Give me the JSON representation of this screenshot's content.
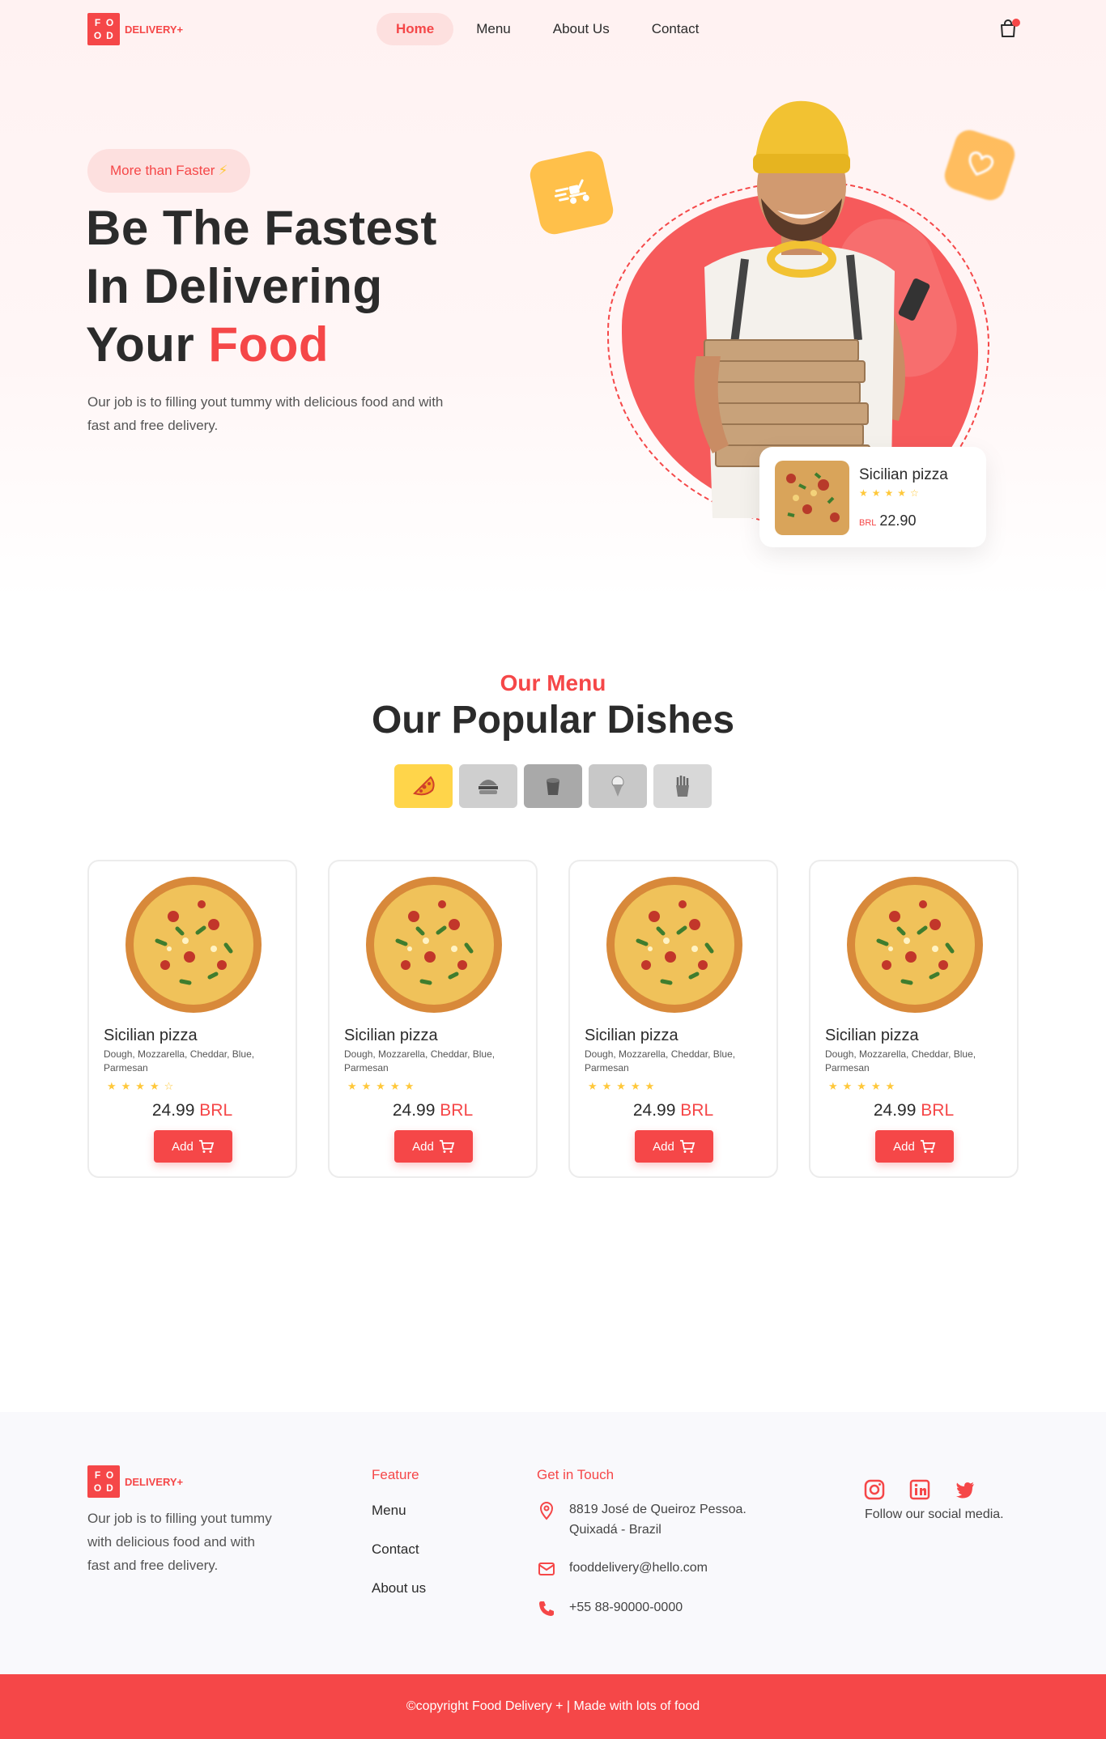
{
  "brand": {
    "logo_letters": [
      "F",
      "O",
      "O",
      "D"
    ],
    "name": "DELIVERY+",
    "accent": "#f54748",
    "star_color": "#ffc83a"
  },
  "nav": {
    "items": [
      "Home",
      "Menu",
      "About Us",
      "Contact"
    ],
    "active": "Home"
  },
  "cart": {
    "icon": "shopping-bag-icon",
    "has_notification": true
  },
  "hero": {
    "badge": "More than Faster",
    "badge_icon": "⚡",
    "title_line1": "Be The Fastest",
    "title_line2": "In Delivering",
    "title_line3_plain": "Your",
    "title_line3_accent": "Food",
    "description": "Our job is to filling yout tummy with delicious food and with fast and free delivery.",
    "featured": {
      "name": "Sicilian pizza",
      "rating": 4,
      "max_rating": 5,
      "currency": "BRL",
      "price": "22.90"
    }
  },
  "menu": {
    "subtitle": "Our Menu",
    "title": "Our Popular Dishes",
    "categories": [
      "pizza-icon",
      "burger-icon",
      "drink-icon",
      "ice-cream-icon",
      "fries-icon"
    ],
    "active_category": "pizza-icon",
    "dishes": [
      {
        "name": "Sicilian pizza",
        "description": "Dough, Mozzarella, Cheddar, Blue, Parmesan",
        "rating": 4,
        "price": "24.99",
        "currency": "BRL",
        "add_label": "Add"
      },
      {
        "name": "Sicilian pizza",
        "description": "Dough, Mozzarella, Cheddar, Blue, Parmesan",
        "rating": 5,
        "price": "24.99",
        "currency": "BRL",
        "add_label": "Add"
      },
      {
        "name": "Sicilian pizza",
        "description": "Dough, Mozzarella, Cheddar, Blue, Parmesan",
        "rating": 5,
        "price": "24.99",
        "currency": "BRL",
        "add_label": "Add"
      },
      {
        "name": "Sicilian pizza",
        "description": "Dough, Mozzarella, Cheddar, Blue, Parmesan",
        "rating": 5,
        "price": "24.99",
        "currency": "BRL",
        "add_label": "Add"
      }
    ]
  },
  "footer": {
    "description": "Our job is to filling yout tummy with delicious food and with fast and free delivery.",
    "feature_heading": "Feature",
    "feature_links": [
      "Menu",
      "Contact",
      "About us"
    ],
    "contact_heading": "Get in Touch",
    "address_line1": "8819 José de Queiroz Pessoa.",
    "address_line2": "Quixadá - Brazil",
    "email": "fooddelivery@hello.com",
    "phone": "+55 88-90000-0000",
    "social_icons": [
      "instagram-icon",
      "linkedin-icon",
      "twitter-icon"
    ],
    "follow_text": "Follow our social media.",
    "copyright": "©copyright Food Delivery + | Made with lots of food"
  }
}
